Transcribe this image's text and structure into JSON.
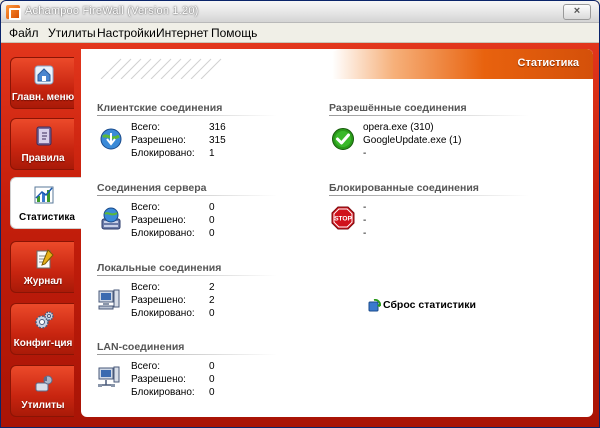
{
  "window": {
    "title": "Achampoo FireWall (Version 1.20)",
    "close_glyph": "×"
  },
  "menu": [
    "Файл",
    "Утилиты",
    "Настройки",
    "Интернет",
    "Помощь"
  ],
  "nav": [
    {
      "label": "Главн. меню",
      "icon": "home-icon",
      "active": false
    },
    {
      "label": "Правила",
      "icon": "rules-book-icon",
      "active": false
    },
    {
      "label": "Статистика",
      "icon": "statistics-chart-icon",
      "active": true
    },
    {
      "label": "Журнал",
      "icon": "journal-icon",
      "active": false
    },
    {
      "label": "Конфиг-ция",
      "icon": "gears-icon",
      "active": false
    },
    {
      "label": "Утилиты",
      "icon": "tools-icon",
      "active": false
    }
  ],
  "header": {
    "title": "Статистика"
  },
  "labels": {
    "total": "Всего:",
    "allowed": "Разрешено:",
    "blocked": "Блокировано:"
  },
  "sections": {
    "client": {
      "title": "Клиентские соединения",
      "icon": "globe-download-icon",
      "total": "316",
      "allowed": "315",
      "blocked": "1"
    },
    "server": {
      "title": "Соединения сервера",
      "icon": "server-globe-icon",
      "total": "0",
      "allowed": "0",
      "blocked": "0"
    },
    "local": {
      "title": "Локальные соединения",
      "icon": "computer-icon",
      "total": "2",
      "allowed": "2",
      "blocked": "0"
    },
    "lan": {
      "title": "LAN-соединения",
      "icon": "network-computer-icon",
      "total": "0",
      "allowed": "0",
      "blocked": "0"
    }
  },
  "allowed_connections": {
    "title": "Разрешённые соединения",
    "icon": "green-check-icon",
    "lines": [
      "opera.exe (310)",
      "GoogleUpdate.exe (1)",
      "-"
    ]
  },
  "blocked_connections": {
    "title": "Блокированные соединения",
    "icon": "stop-sign-icon",
    "stop_text": "STOP",
    "lines": [
      "-",
      "-",
      "-"
    ]
  },
  "reset": {
    "label": "Сброс статистики",
    "icon": "reset-icon"
  },
  "colors": {
    "brand_red": "#c21c0b",
    "header_orange": "#e8620e",
    "check_green": "#2a9a1a",
    "stop_red": "#d0121b"
  }
}
